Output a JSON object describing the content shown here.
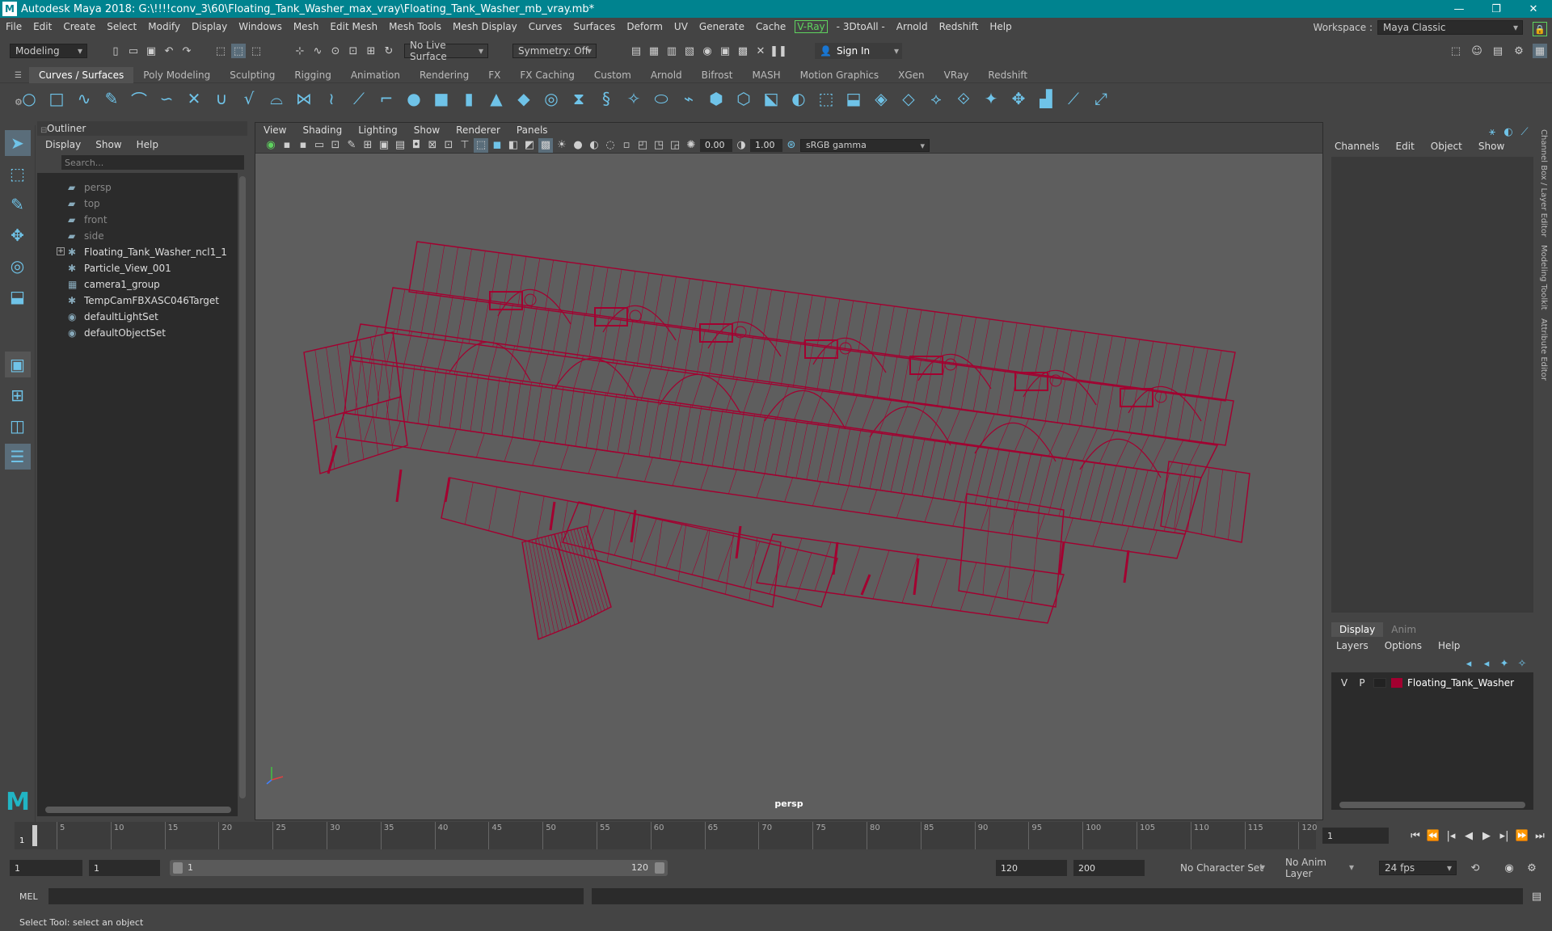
{
  "app": {
    "title": "Autodesk Maya 2018: G:\\!!!!conv_3\\60\\Floating_Tank_Washer_max_vray\\Floating_Tank_Washer_mb_vray.mb*",
    "accent": "#00838f",
    "wire_color": "#a30030"
  },
  "menu": [
    "File",
    "Edit",
    "Create",
    "Select",
    "Modify",
    "Display",
    "Windows",
    "Mesh",
    "Edit Mesh",
    "Mesh Tools",
    "Mesh Display",
    "Curves",
    "Surfaces",
    "Deform",
    "UV",
    "Generate",
    "Cache",
    "V-Ray",
    "- 3DtoAll -",
    "Arnold",
    "Redshift",
    "Help"
  ],
  "workspace": {
    "label": "Workspace :",
    "value": "Maya Classic"
  },
  "status": {
    "mode": "Modeling",
    "live_surface": "No Live Surface",
    "symmetry": "Symmetry: Off",
    "sign_in": "Sign In"
  },
  "shelf_tabs": [
    "Curves / Surfaces",
    "Poly Modeling",
    "Sculpting",
    "Rigging",
    "Animation",
    "Rendering",
    "FX",
    "FX Caching",
    "Custom",
    "Arnold",
    "Bifrost",
    "MASH",
    "Motion Graphics",
    "XGen",
    "VRay",
    "Redshift"
  ],
  "outliner": {
    "title": "Outliner",
    "menu": [
      "Display",
      "Show",
      "Help"
    ],
    "search_placeholder": "Search...",
    "items": [
      {
        "label": "persp",
        "icon": "camera-icon",
        "dim": true
      },
      {
        "label": "top",
        "icon": "camera-icon",
        "dim": true
      },
      {
        "label": "front",
        "icon": "camera-icon",
        "dim": true
      },
      {
        "label": "side",
        "icon": "camera-icon",
        "dim": true
      },
      {
        "label": "Floating_Tank_Washer_ncl1_1",
        "icon": "transform-icon",
        "dim": false
      },
      {
        "label": "Particle_View_001",
        "icon": "transform-icon",
        "dim": false
      },
      {
        "label": "camera1_group",
        "icon": "group-icon",
        "dim": false
      },
      {
        "label": "TempCamFBXASC046Target",
        "icon": "transform-icon",
        "dim": false
      },
      {
        "label": "defaultLightSet",
        "icon": "set-icon",
        "dim": false
      },
      {
        "label": "defaultObjectSet",
        "icon": "set-icon",
        "dim": false
      }
    ]
  },
  "viewport": {
    "menu": [
      "View",
      "Shading",
      "Lighting",
      "Show",
      "Renderer",
      "Panels"
    ],
    "exposure": "0.00",
    "gamma": "1.00",
    "colorspace": "sRGB gamma",
    "camera": "persp"
  },
  "channel_box": {
    "menu": [
      "Channels",
      "Edit",
      "Object",
      "Show"
    ]
  },
  "layer_editor": {
    "tabs": [
      "Display",
      "Anim"
    ],
    "menu": [
      "Layers",
      "Options",
      "Help"
    ],
    "layer": {
      "v": "V",
      "p": "P",
      "name": "Floating_Tank_Washer"
    }
  },
  "side_tabs": [
    "Channel Box / Layer Editor",
    "Modeling Toolkit",
    "Attribute Editor"
  ],
  "timeline": {
    "ticks": [
      "5",
      "10",
      "15",
      "20",
      "25",
      "30",
      "35",
      "40",
      "45",
      "50",
      "55",
      "60",
      "65",
      "70",
      "75",
      "80",
      "85",
      "90",
      "95",
      "100",
      "105",
      "110",
      "115",
      "120"
    ],
    "start_label": "1",
    "current_frame": "1"
  },
  "range": {
    "start": "1",
    "anim_start": "1",
    "slider_start": "1",
    "slider_end": "120",
    "end": "120",
    "anim_end": "200",
    "character_set": "No Character Set",
    "anim_layer": "No Anim Layer",
    "fps": "24 fps"
  },
  "cmd": {
    "label": "MEL"
  },
  "help_line": "Select Tool: select an object"
}
